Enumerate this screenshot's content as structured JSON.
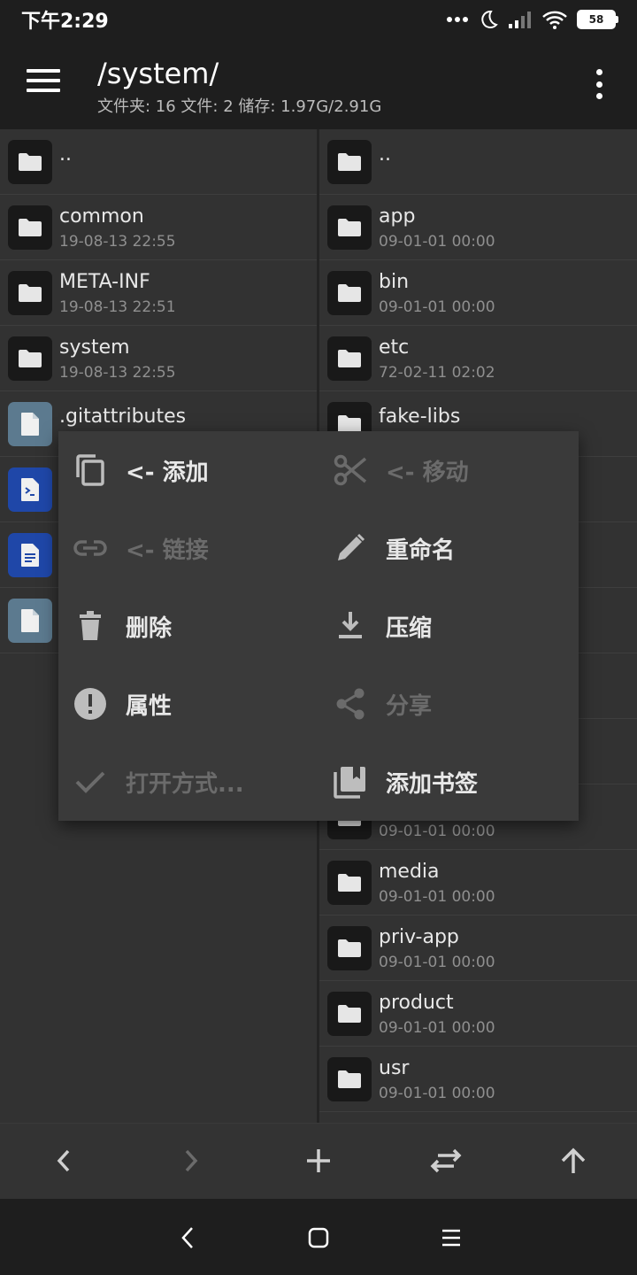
{
  "status": {
    "time": "下午2:29",
    "battery": "58"
  },
  "appbar": {
    "title": "/system/",
    "subtitle": "文件夹: 16  文件: 2  储存: 1.97G/2.91G"
  },
  "left_pane": [
    {
      "name": "..",
      "date": "",
      "icon": "folder-icon"
    },
    {
      "name": "common",
      "date": "19-08-13 22:55",
      "icon": "folder-icon"
    },
    {
      "name": "META-INF",
      "date": "19-08-13 22:51",
      "icon": "folder-icon"
    },
    {
      "name": "system",
      "date": "19-08-13 22:55",
      "icon": "folder-icon"
    },
    {
      "name": ".gitattributes",
      "date": "",
      "icon": "file-icon"
    },
    {
      "name": "",
      "date": "",
      "icon": "script-file-icon"
    },
    {
      "name": "",
      "date": "",
      "icon": "text-file-icon"
    },
    {
      "name": "",
      "date": "",
      "icon": "file-icon"
    }
  ],
  "right_pane": [
    {
      "name": "..",
      "date": ""
    },
    {
      "name": "app",
      "date": "09-01-01 00:00"
    },
    {
      "name": "bin",
      "date": "09-01-01 00:00"
    },
    {
      "name": "etc",
      "date": "72-02-11 02:02"
    },
    {
      "name": "fake-libs",
      "date": ""
    },
    {
      "name": "",
      "date": ""
    },
    {
      "name": "",
      "date": ""
    },
    {
      "name": "",
      "date": ""
    },
    {
      "name": "",
      "date": ""
    },
    {
      "name": "",
      "date": ""
    },
    {
      "name": "",
      "date": "09-01-01 00:00"
    },
    {
      "name": "media",
      "date": "09-01-01 00:00"
    },
    {
      "name": "priv-app",
      "date": "09-01-01 00:00"
    },
    {
      "name": "product",
      "date": "09-01-01 00:00"
    },
    {
      "name": "usr",
      "date": "09-01-01 00:00"
    },
    {
      "name": "",
      "date": ""
    }
  ],
  "menu": {
    "copy_add": "<- 添加",
    "move_add": "<- 移动",
    "link_add": "<- 链接",
    "rename": "重命名",
    "delete": "删除",
    "compress": "压缩",
    "properties": "属性",
    "share": "分享",
    "open_with": "打开方式...",
    "add_bookmark": "添加书签"
  },
  "colors": {
    "background": "#2d2d2d",
    "bar": "#1e1e1e",
    "menu": "#3a3a3a",
    "disabled": "#6b6b6b",
    "blue_tile": "#1f47a8",
    "doc_tile": "#5c7a8f"
  }
}
